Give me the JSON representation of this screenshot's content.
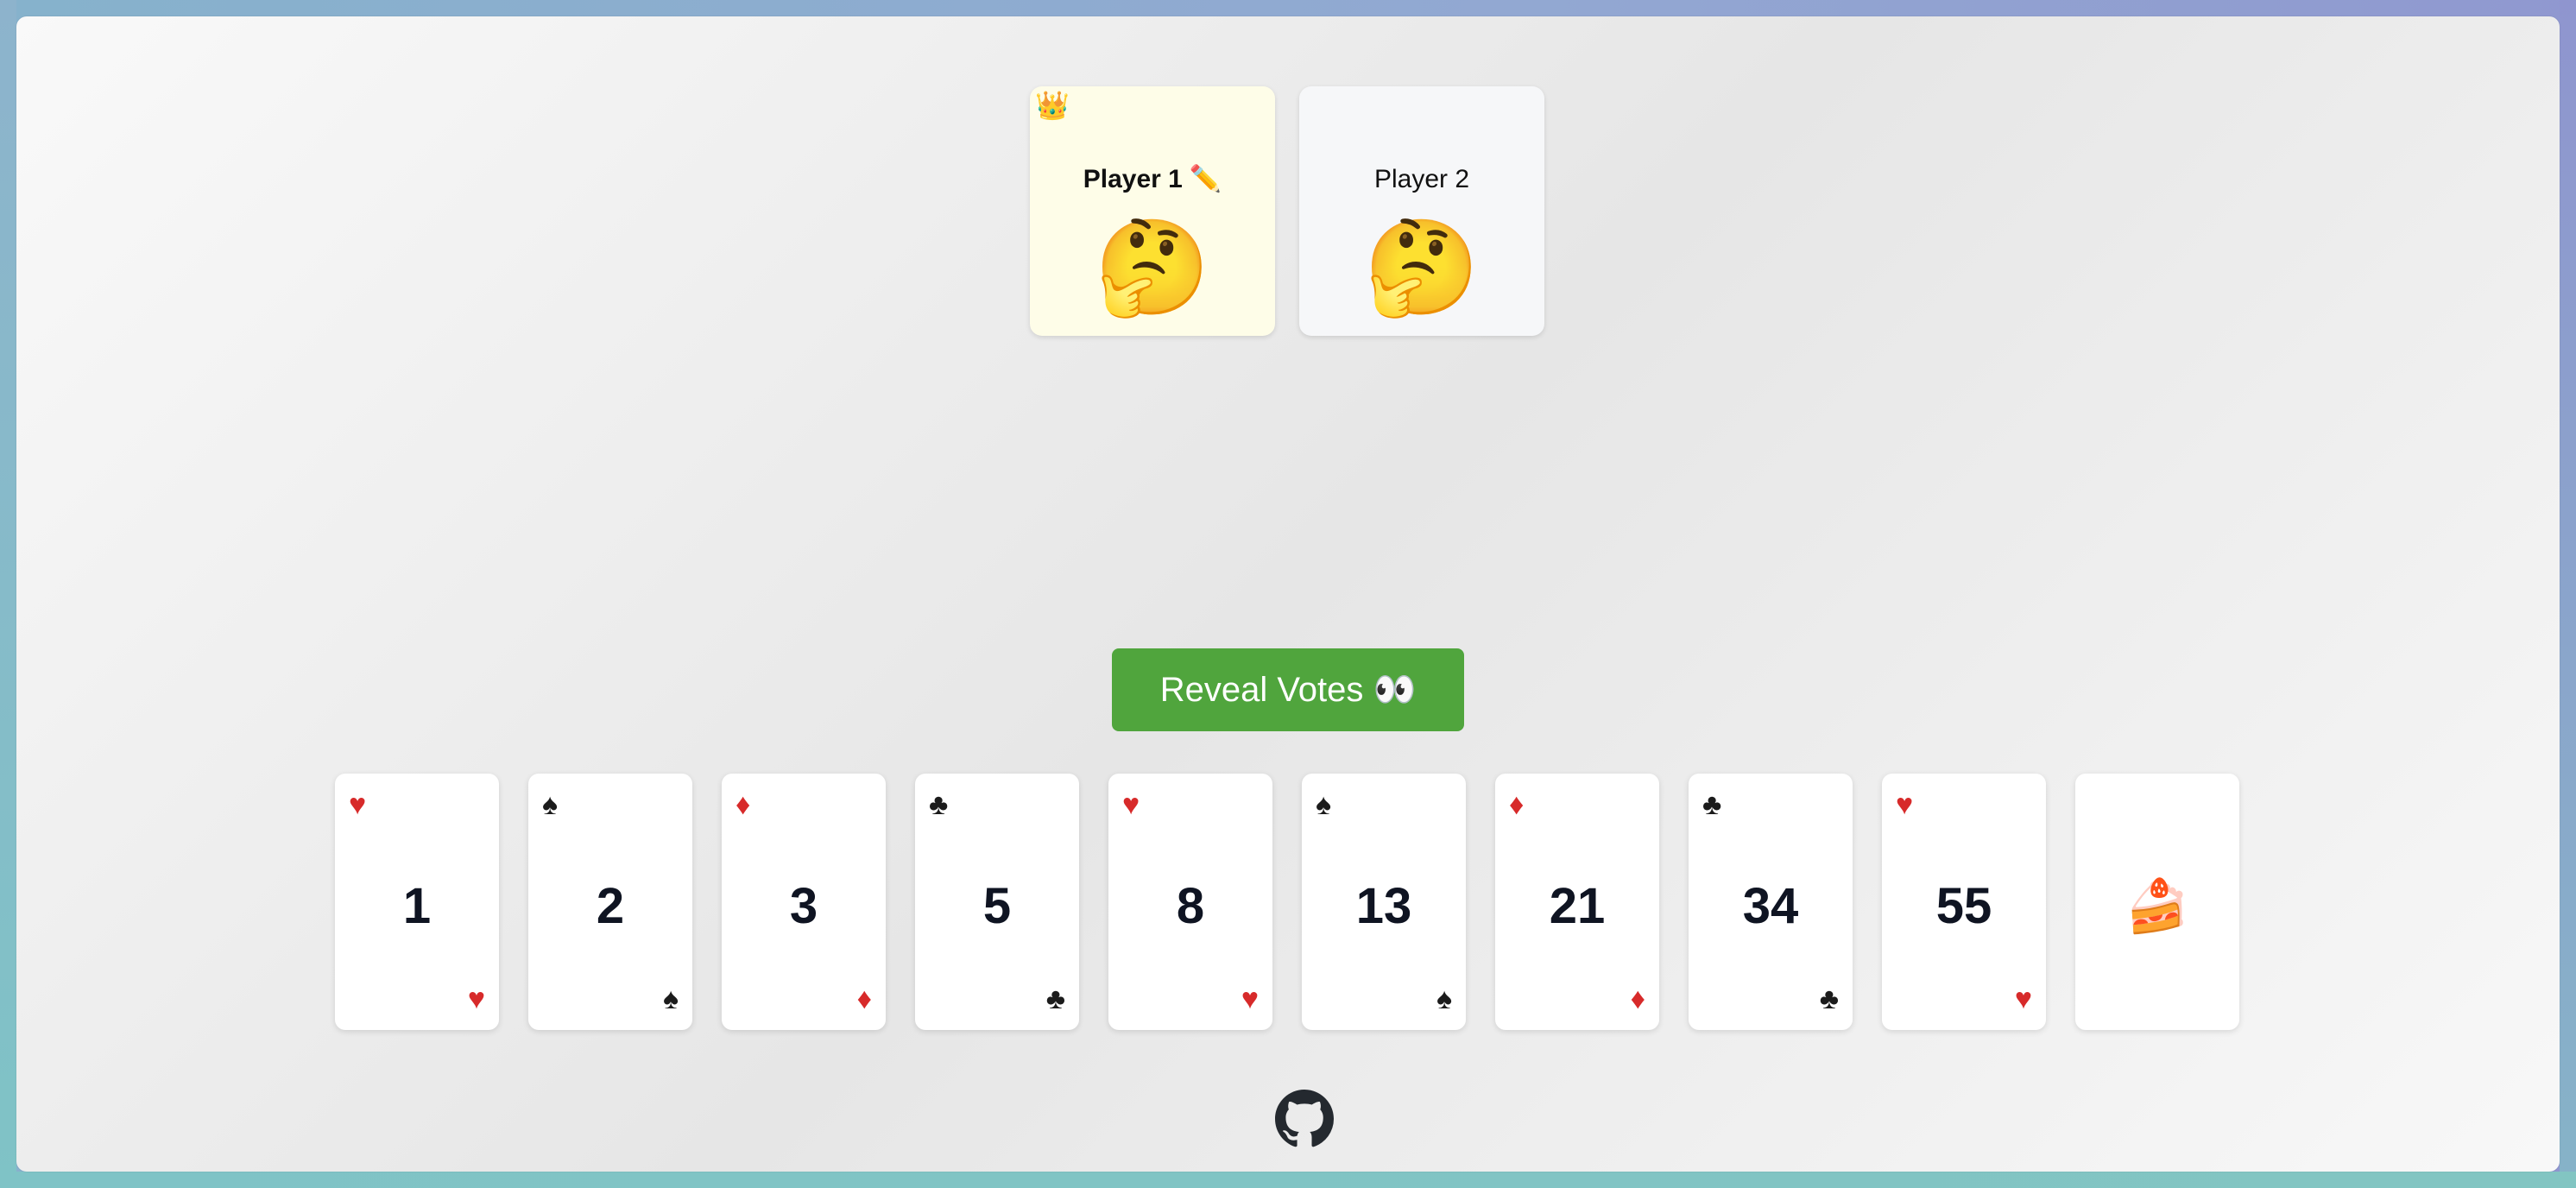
{
  "players": [
    {
      "name": "Player 1",
      "is_host": true,
      "editable": true,
      "status_emoji": "🤔",
      "crown_emoji": "👑",
      "edit_emoji": "✏️"
    },
    {
      "name": "Player 2",
      "is_host": false,
      "editable": false,
      "status_emoji": "🤔"
    }
  ],
  "reveal_button": {
    "label": "Reveal Votes 👀"
  },
  "cards": [
    {
      "value": "1",
      "suit": "♥",
      "color": "red"
    },
    {
      "value": "2",
      "suit": "♠",
      "color": "black"
    },
    {
      "value": "3",
      "suit": "♦",
      "color": "red"
    },
    {
      "value": "5",
      "suit": "♣",
      "color": "black"
    },
    {
      "value": "8",
      "suit": "♥",
      "color": "red"
    },
    {
      "value": "13",
      "suit": "♠",
      "color": "black"
    },
    {
      "value": "21",
      "suit": "♦",
      "color": "red"
    },
    {
      "value": "34",
      "suit": "♣",
      "color": "black"
    },
    {
      "value": "55",
      "suit": "♥",
      "color": "red"
    },
    {
      "value": "🍰",
      "suit": "",
      "color": "none"
    }
  ],
  "footer": {
    "icon": "github-icon"
  },
  "colors": {
    "button": "#50a53d",
    "host_card": "#fefde8",
    "player_card": "#f6f7f9",
    "red_suit": "#d72a2a"
  }
}
